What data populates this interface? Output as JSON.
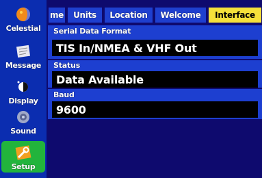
{
  "sidebar": {
    "items": [
      {
        "label": "Celestial",
        "icon": "celestial-icon"
      },
      {
        "label": "Message",
        "icon": "message-icon"
      },
      {
        "label": "Display",
        "icon": "display-icon"
      },
      {
        "label": "Sound",
        "icon": "sound-icon"
      },
      {
        "label": "Setup",
        "icon": "setup-icon",
        "selected": true
      }
    ]
  },
  "tabs": [
    {
      "label": "me"
    },
    {
      "label": "Units"
    },
    {
      "label": "Location"
    },
    {
      "label": "Welcome"
    },
    {
      "label": "Interface",
      "active": true
    }
  ],
  "fields": {
    "serial": {
      "label": "Serial Data Format",
      "value": "TIS In/NMEA & VHF Out"
    },
    "status": {
      "label": "Status",
      "value": "Data Available"
    },
    "baud": {
      "label": "Baud",
      "value": "9600"
    }
  },
  "colors": {
    "sidebar": "#0b2db0",
    "tab": "#1e3fcf",
    "tab_active": "#f5e03a",
    "selected_item": "#22b43c",
    "background": "#0e0a6e"
  }
}
